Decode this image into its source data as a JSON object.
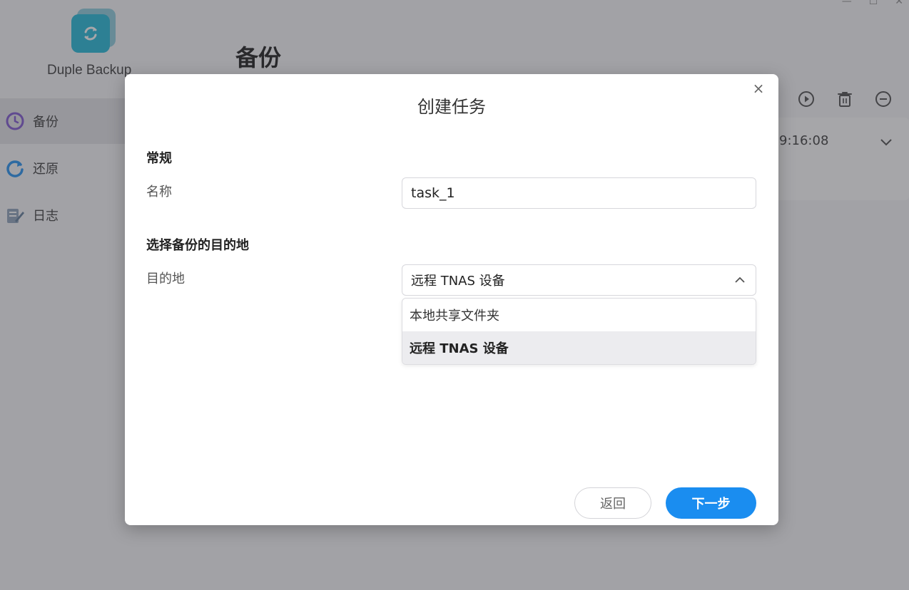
{
  "app": {
    "name": "Duple Backup",
    "page_title": "备份",
    "nav": [
      {
        "label": "备份",
        "icon": "clock-icon",
        "active": true
      },
      {
        "label": "还原",
        "icon": "restore-icon",
        "active": false
      },
      {
        "label": "日志",
        "icon": "log-icon",
        "active": false
      }
    ],
    "task": {
      "time": "9:16:08"
    }
  },
  "dialog": {
    "title": "创建任务",
    "close_label": "×",
    "general": {
      "section_title": "常规",
      "name_label": "名称",
      "name_value": "task_1"
    },
    "destination": {
      "section_title": "选择备份的目的地",
      "label": "目的地",
      "selected": "远程 TNAS 设备",
      "options": [
        "本地共享文件夹",
        "远程 TNAS 设备"
      ]
    },
    "buttons": {
      "back": "返回",
      "next": "下一步"
    }
  },
  "colors": {
    "accent": "#1a8df0",
    "logo": "#18b6d6",
    "nav_clock": "#7a4fd0",
    "nav_restore": "#1a8df0"
  }
}
